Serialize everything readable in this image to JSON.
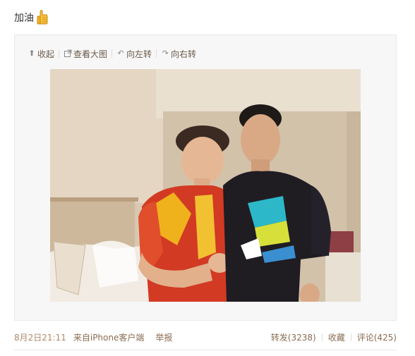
{
  "post": {
    "text": "加油",
    "emoji_icon": "thumbs-up-icon"
  },
  "toolbar": {
    "collapse_label": "收起",
    "view_large_label": "查看大图",
    "rotate_left_label": "向左转",
    "rotate_right_label": "向右转"
  },
  "footer": {
    "time": "8月2日21:11",
    "source": "来自iPhone客户端",
    "report": "举报",
    "repost_label": "转发",
    "repost_count": "(3238)",
    "favorite_label": "收藏",
    "comment_label": "评论",
    "comment_count": "(425)"
  },
  "colors": {
    "link": "#8a6c52",
    "time": "#b08a6b",
    "panel_bg": "#f7f7f7",
    "panel_border": "#e9e9e9"
  }
}
